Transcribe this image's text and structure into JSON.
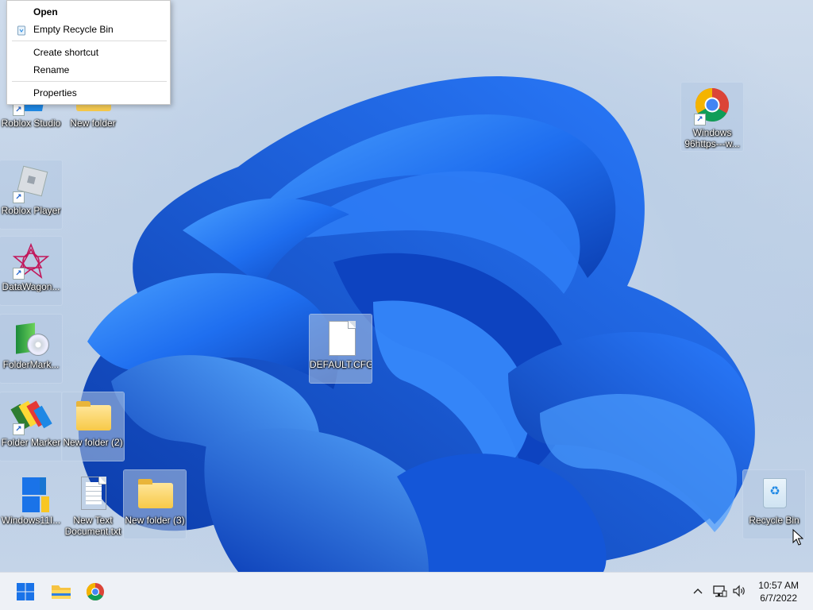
{
  "context_menu": {
    "items": [
      {
        "label": "Open",
        "bold": true
      },
      {
        "label": "Empty Recycle Bin",
        "icon": "recycle-bin-icon"
      },
      {
        "label": "Create shortcut"
      },
      {
        "label": "Rename"
      },
      {
        "label": "Properties"
      }
    ]
  },
  "desktop": {
    "icons": {
      "roblox_studio": "Roblox Studio",
      "new_folder": "New folder",
      "roblox_player": "Roblox Player",
      "datawagon": "DataWagon...",
      "foldermark": "FolderMark...",
      "folder_marker": "Folder Marker",
      "new_folder_2": "New folder (2)",
      "windows11": "Windows11I...",
      "new_text_document": "New Text Document.txt",
      "new_folder_3": "New folder (3)",
      "default_cfg": "DEFAULT.CFG",
      "windows96": "Windows 96https---w...",
      "recycle_bin": "Recycle Bin"
    }
  },
  "taskbar": {
    "clock_time": "10:57 AM",
    "clock_date": "6/7/2022"
  },
  "colors": {
    "accent": "#1a73e8",
    "bloom_dark": "#0a3fb5",
    "bloom_light": "#3d8bff",
    "taskbar_bg": "#eef1f6"
  }
}
